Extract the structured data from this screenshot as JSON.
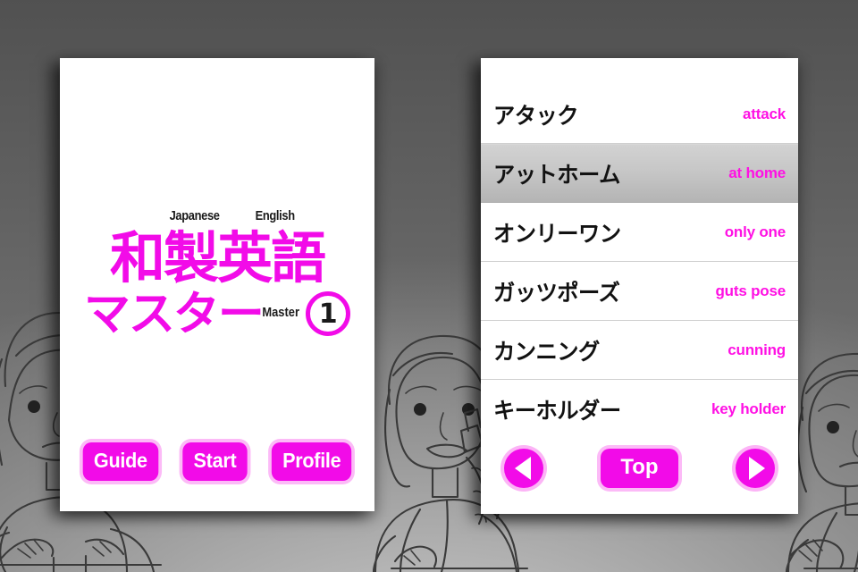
{
  "background": {
    "base_color": "#6e6e6e",
    "art_description": "grayscale line-art characters"
  },
  "title_screen": {
    "logo": {
      "japanese_label": "Japanese",
      "english_label": "English",
      "master_label": "Master",
      "main_text_line1": "和製英語",
      "main_text_line2": "マスター",
      "volume_number": "1",
      "accent_color": "#F20BE8"
    },
    "buttons": [
      {
        "label": "Guide"
      },
      {
        "label": "Start"
      },
      {
        "label": "Profile"
      }
    ]
  },
  "list_screen": {
    "rows": [
      {
        "japanese": "アタック",
        "english": "attack",
        "selected": false
      },
      {
        "japanese": "アットホーム",
        "english": "at home",
        "selected": true
      },
      {
        "japanese": "オンリーワン",
        "english": "only one",
        "selected": false
      },
      {
        "japanese": "ガッツポーズ",
        "english": "guts pose",
        "selected": false
      },
      {
        "japanese": "カンニング",
        "english": "cunning",
        "selected": false
      },
      {
        "japanese": "キーホルダー",
        "english": "key holder",
        "selected": false
      }
    ],
    "nav": {
      "prev_label": "◀",
      "top_label": "Top",
      "next_label": "▶"
    }
  }
}
